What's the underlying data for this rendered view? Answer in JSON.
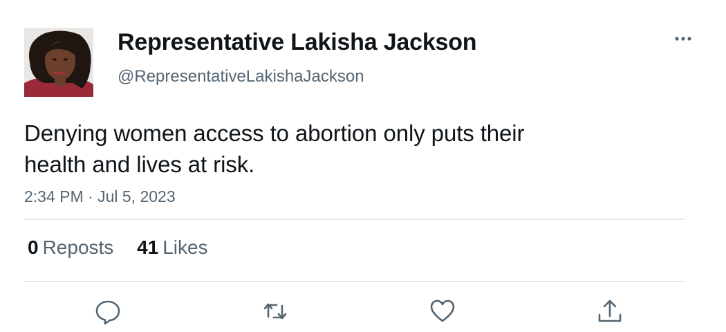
{
  "author": {
    "display_name": "Representative Lakisha Jackson",
    "handle": "@RepresentativeLakishaJackson"
  },
  "tweet": {
    "text_line_1": "Denying women access to abortion only puts their",
    "text_line_2": "health and lives at risk.",
    "timestamp": "2:34 PM · Jul 5, 2023"
  },
  "stats": {
    "reposts_count": "0",
    "reposts_label": "Reposts",
    "likes_count": "41",
    "likes_label": "Likes"
  },
  "icons": {
    "more": "more-horizontal-icon",
    "reply": "reply-icon",
    "repost": "repost-icon",
    "like": "heart-icon",
    "share": "share-icon"
  },
  "colors": {
    "text_primary": "#0f1419",
    "text_secondary": "#536471",
    "divider": "#e1e6ea"
  }
}
